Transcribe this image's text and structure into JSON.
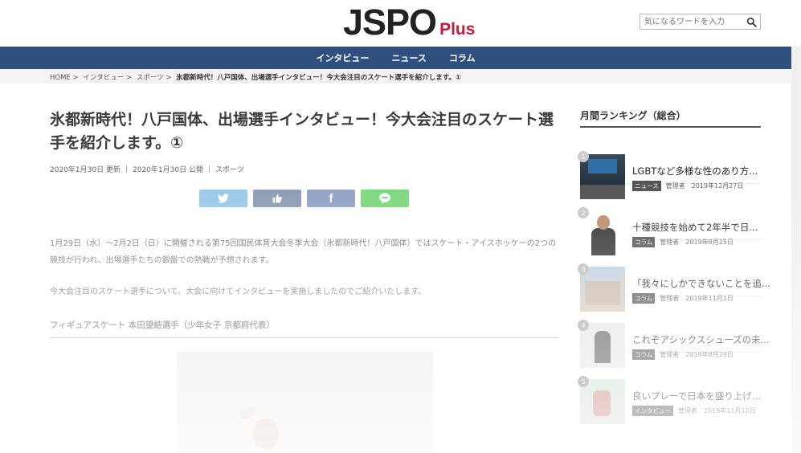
{
  "header": {
    "logo_main": "JSPO",
    "logo_sub": "Plus",
    "search_placeholder": "気になるワードを入力"
  },
  "nav": {
    "items": [
      "インタビュー",
      "ニュース",
      "コラム"
    ]
  },
  "breadcrumb": {
    "items": [
      "HOME >",
      "インタビュー >",
      "スポーツ >"
    ],
    "current": "氷都新時代！八戸国体、出場選手インタビュー！今大会注目のスケート選手を紹介します。①"
  },
  "article": {
    "title": "氷都新時代！八戸国体、出場選手インタビュー！今大会注目のスケート選手を紹介します。①",
    "updated": "2020年1月30日 更新",
    "published": "2020年1月30日 公開",
    "category": "スポーツ",
    "share": {
      "twitter_icon": "twitter-icon",
      "like_icon": "thumbs-up-icon",
      "facebook_icon": "facebook-icon",
      "line_icon": "line-icon",
      "facebook_label": "f"
    },
    "paragraph1": "1月29日（水）～2月2日（日）に開催される第75回国民体育大会冬季大会（氷都新時代！八戸国体）ではスケート・アイスホッケーの2つの競技が行われ、出場選手たちの銀盤での熱戦が予想されます。",
    "paragraph2": "今大会注目のスケート選手について、大会に向けてインタビューを実施しましたのでご紹介いたします。",
    "subheading": "フィギュアスケート 本田望結選手（少年女子 京都府代表）"
  },
  "sidebar": {
    "title": "月間ランキング（総合）",
    "items": [
      {
        "rank": "1",
        "title": "LGBTなど多様な性のあり方...",
        "tag": "ニュース",
        "author": "管理者",
        "date": "2019年12月27日"
      },
      {
        "rank": "2",
        "title": "十種競技を始めて2年半で日...",
        "tag": "コラム",
        "author": "管理者",
        "date": "2019年8月25日"
      },
      {
        "rank": "3",
        "title": "「我々にしかできないことを追...",
        "tag": "コラム",
        "author": "管理者",
        "date": "2019年11月1日"
      },
      {
        "rank": "4",
        "title": "これぞアシックスシューズの未...",
        "tag": "コラム",
        "author": "管理者",
        "date": "2019年8月29日"
      },
      {
        "rank": "5",
        "title": "良いプレーで日本を盛り上げ...",
        "tag": "インタビュー",
        "author": "管理者",
        "date": "2019年11月12日"
      }
    ]
  }
}
